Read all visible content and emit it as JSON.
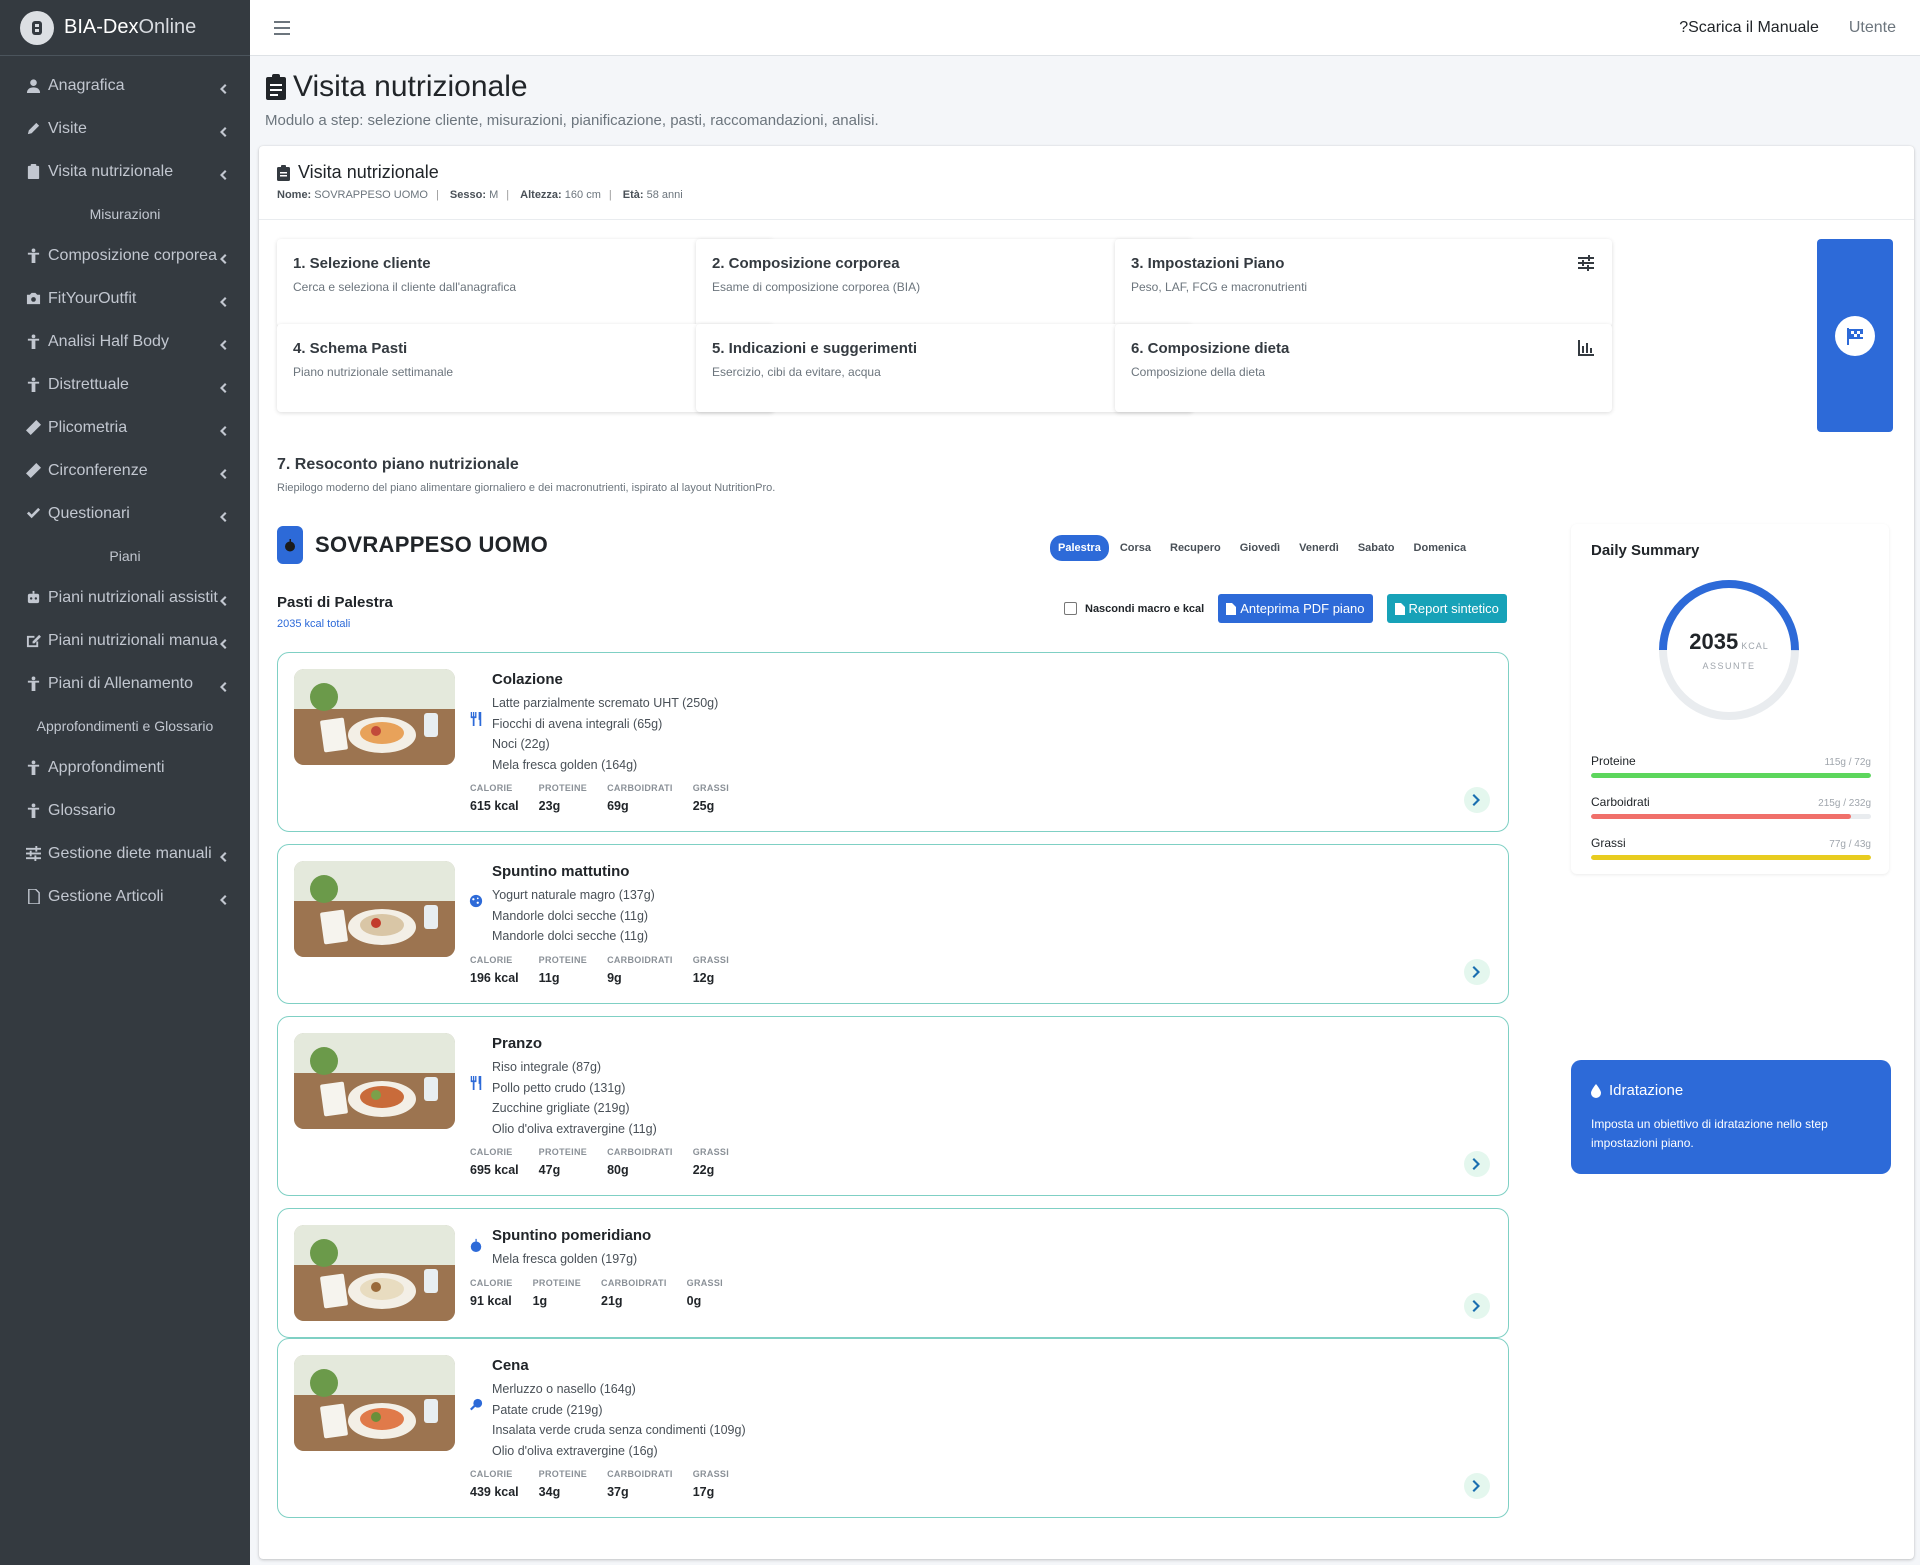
{
  "brand": {
    "name_bold": "BIA-Dex",
    "name_thin": "Online"
  },
  "sidebar": {
    "items": [
      {
        "label": "Anagrafica",
        "icon": "user-icon",
        "chevron": true
      },
      {
        "label": "Visite",
        "icon": "pencil-icon",
        "chevron": true
      },
      {
        "label": "Visita nutrizionale",
        "icon": "clipboard-icon",
        "chevron": true
      },
      {
        "label": "Misurazioni",
        "sub": true
      },
      {
        "label": "Composizione corporea",
        "icon": "person-icon",
        "chevron": true
      },
      {
        "label": "FitYourOutfit",
        "icon": "camera-icon",
        "chevron": true
      },
      {
        "label": "Analisi Half Body",
        "icon": "person-icon",
        "chevron": true
      },
      {
        "label": "Distrettuale",
        "icon": "person-icon",
        "chevron": true
      },
      {
        "label": "Plicometria",
        "icon": "ruler-icon",
        "chevron": true
      },
      {
        "label": "Circonferenze",
        "icon": "ruler-icon",
        "chevron": true
      },
      {
        "label": "Questionari",
        "icon": "check-icon",
        "chevron": true
      },
      {
        "label": "Piani",
        "sub": true
      },
      {
        "label": "Piani nutrizionali assistiti",
        "icon": "robot-icon",
        "chevron": true
      },
      {
        "label": "Piani nutrizionali manuali",
        "icon": "edit-icon",
        "chevron": true
      },
      {
        "label": "Piani di Allenamento",
        "icon": "person-icon",
        "chevron": true
      },
      {
        "label": "Approfondimenti e Glossario",
        "sub": true
      },
      {
        "label": "Approfondimenti",
        "icon": "person-icon",
        "chevron": false
      },
      {
        "label": "Glossario",
        "icon": "person-icon",
        "chevron": false
      },
      {
        "label": "Gestione diete manuali",
        "icon": "sliders-icon",
        "chevron": true
      },
      {
        "label": "Gestione Articoli",
        "icon": "file-icon",
        "chevron": true
      }
    ]
  },
  "topbar": {
    "manual": "Scarica il Manuale",
    "user": "Utente"
  },
  "page": {
    "title": "Visita nutrizionale",
    "subtitle": "Modulo a step: selezione cliente, misurazioni, pianificazione, pasti, raccomandazioni, analisi."
  },
  "card": {
    "title": "Visita nutrizionale",
    "name_label": "Nome:",
    "name": "SOVRAPPESO UOMO",
    "sex_label": "Sesso:",
    "sex": "M",
    "height_label": "Altezza:",
    "height": "160 cm",
    "age_label": "Età:",
    "age": "58 anni"
  },
  "steps": [
    {
      "title": "1. Selezione cliente",
      "desc": "Cerca e seleziona il cliente dall'anagrafica",
      "icon": "user-icon"
    },
    {
      "title": "2. Composizione corporea",
      "desc": "Esame di composizione corporea (BIA)",
      "icon": "ruler-icon"
    },
    {
      "title": "3. Impostazioni Piano",
      "desc": "Peso, LAF, FCG e macronutrienti",
      "icon": "sliders-icon"
    },
    {
      "title": "4. Schema Pasti",
      "desc": "Piano nutrizionale settimanale",
      "icon": "utensils-icon"
    },
    {
      "title": "5. Indicazioni e suggerimenti",
      "desc": "Esercizio, cibi da evitare, acqua",
      "icon": "running-icon"
    },
    {
      "title": "6. Composizione dieta",
      "desc": "Composizione della dieta",
      "icon": "bar-chart-icon"
    }
  ],
  "reso": {
    "title": "7. Resoconto piano nutrizionale",
    "subtitle": "Riepilogo moderno del piano alimentare giornaliero e dei macronutrienti, ispirato al layout NutritionPro.",
    "client": "SOVRAPPESO UOMO",
    "days": [
      "Palestra",
      "Corsa",
      "Recupero",
      "Giovedì",
      "Venerdì",
      "Sabato",
      "Domenica"
    ],
    "active_day": "Palestra",
    "pasti_title": "Pasti di Palestra",
    "pasti_kcal": "2035 kcal totali",
    "hide_label": "Nascondi macro e kcal",
    "hide_checked": false,
    "btn_pdf": "Anteprima PDF piano",
    "btn_report": "Report sintetico"
  },
  "macro_labels": {
    "cal": "CALORIE",
    "pro": "PROTEINE",
    "carb": "CARBOIDRATI",
    "fat": "GRASSI"
  },
  "meals": [
    {
      "title": "Colazione",
      "icon": "utensils-icon",
      "items": [
        "Latte parzialmente scremato UHT (250g)",
        "Fiocchi di avena integrali (65g)",
        "Noci (22g)",
        "Mela fresca golden (164g)"
      ],
      "cal": "615 kcal",
      "pro": "23g",
      "carb": "69g",
      "fat": "25g"
    },
    {
      "title": "Spuntino mattutino",
      "icon": "cookie-icon",
      "items": [
        "Yogurt naturale magro (137g)",
        "Mandorle dolci secche (11g)",
        "Mandorle dolci secche (11g)"
      ],
      "cal": "196 kcal",
      "pro": "11g",
      "carb": "9g",
      "fat": "12g"
    },
    {
      "title": "Pranzo",
      "icon": "utensils-icon",
      "items": [
        "Riso integrale (87g)",
        "Pollo petto crudo (131g)",
        "Zucchine grigliate (219g)",
        "Olio d'oliva extravergine (11g)"
      ],
      "cal": "695 kcal",
      "pro": "47g",
      "carb": "80g",
      "fat": "22g"
    },
    {
      "title": "Spuntino pomeridiano",
      "icon": "apple-icon",
      "items": [
        "Mela fresca golden (197g)"
      ],
      "cal": "91 kcal",
      "pro": "1g",
      "carb": "21g",
      "fat": "0g"
    },
    {
      "title": "Cena",
      "icon": "drumstick-icon",
      "items": [
        "Merluzzo o nasello (164g)",
        "Patate crude (219g)",
        "Insalata verde cruda senza condimenti (109g)",
        "Olio d'oliva extravergine (16g)"
      ],
      "cal": "439 kcal",
      "pro": "34g",
      "carb": "37g",
      "fat": "17g"
    }
  ],
  "summary": {
    "title": "Daily Summary",
    "kcal": "2035",
    "kcal_unit": "KCAL",
    "kcal_label": "ASSUNTE",
    "donut_fraction": 0.5,
    "bars": [
      {
        "name": "Proteine",
        "value": "115g / 72g",
        "fill": 1.0,
        "color": "#5cd65c"
      },
      {
        "name": "Carboidrati",
        "value": "215g / 232g",
        "fill": 0.93,
        "color": "#f0706a"
      },
      {
        "name": "Grassi",
        "value": "77g / 43g",
        "fill": 1.0,
        "color": "#e8cc1f"
      }
    ]
  },
  "hydration": {
    "title": "Idratazione",
    "text": "Imposta un obiettivo di idratazione nello step impostazioni piano."
  },
  "colors": {
    "primary": "#2d6ad8",
    "info": "#17a2b8",
    "sidebar": "#343a40",
    "meal_border": "#7fd0c4"
  }
}
